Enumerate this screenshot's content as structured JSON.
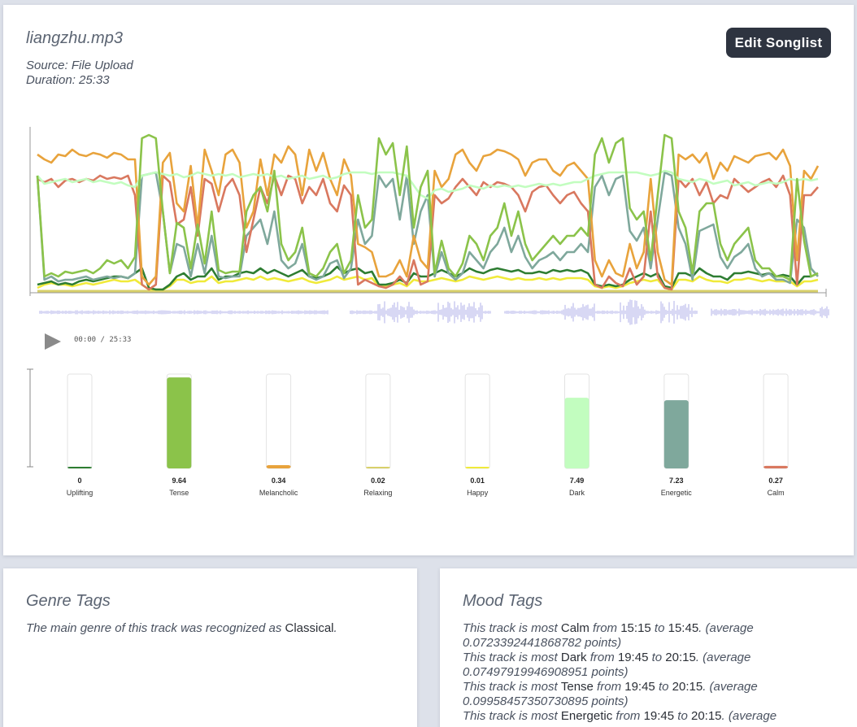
{
  "track": {
    "title": "liangzhu.mp3",
    "source": "Source: File Upload",
    "duration": "Duration: 25:33"
  },
  "toolbar": {
    "edit_label": "Edit Songlist"
  },
  "player": {
    "current": "00:00",
    "separator": " / ",
    "total": "25:33"
  },
  "colors": {
    "tense": "#8bc34a",
    "melancholic": "#e8a33c",
    "calm": "#d9785f",
    "dark": "#c2fdbf",
    "energetic": "#7fa89c",
    "uplifting": "#2e7d32",
    "happy": "#f0ea3a",
    "relaxing": "#d8d06a",
    "waveform": "#c8c8f0"
  },
  "chart_data": {
    "type": "line",
    "x_range": [
      0,
      1
    ],
    "ylim": [
      0,
      1
    ],
    "series": [
      {
        "name": "Tense",
        "key": "tense",
        "values": [
          0.72,
          0.1,
          0.12,
          0.1,
          0.13,
          0.12,
          0.13,
          0.14,
          0.12,
          0.15,
          0.2,
          0.18,
          0.2,
          0.15,
          0.22,
          0.95,
          0.97,
          0.95,
          0.5,
          0.12,
          0.43,
          0.4,
          0.15,
          0.42,
          0.18,
          0.5,
          0.14,
          0.12,
          0.13,
          0.13,
          0.5,
          0.6,
          0.65,
          0.5,
          0.75,
          0.3,
          0.2,
          0.25,
          0.4,
          0.12,
          0.1,
          0.15,
          0.25,
          0.3,
          0.12,
          0.2,
          0.6,
          0.4,
          0.45,
          0.95,
          0.85,
          0.92,
          0.6,
          0.9,
          0.4,
          0.65,
          0.75,
          0.12,
          0.32,
          0.15,
          0.1,
          0.18,
          0.35,
          0.3,
          0.2,
          0.35,
          0.4,
          0.55,
          0.35,
          0.5,
          0.3,
          0.2,
          0.25,
          0.3,
          0.35,
          0.3,
          0.35,
          0.35,
          0.4,
          0.35,
          0.85,
          0.95,
          0.8,
          0.92,
          0.95,
          0.52,
          0.45,
          0.5,
          0.2,
          0.6,
          0.97,
          0.95,
          0.5,
          0.4,
          0.12,
          0.5,
          0.55,
          0.55,
          0.3,
          0.2,
          0.3,
          0.35,
          0.4,
          0.2,
          0.15,
          0.15,
          0.1,
          0.1,
          0.08,
          0.7,
          0.32,
          0.1,
          0.12
        ]
      },
      {
        "name": "Melancholic",
        "key": "melancholic",
        "values": [
          0.85,
          0.82,
          0.8,
          0.85,
          0.84,
          0.88,
          0.85,
          0.84,
          0.86,
          0.85,
          0.83,
          0.86,
          0.85,
          0.82,
          0.82,
          0.1,
          0.05,
          0.1,
          0.8,
          0.86,
          0.55,
          0.5,
          0.78,
          0.4,
          0.88,
          0.75,
          0.6,
          0.85,
          0.88,
          0.8,
          0.4,
          0.5,
          0.82,
          0.6,
          0.85,
          0.8,
          0.9,
          0.85,
          0.6,
          0.88,
          0.75,
          0.86,
          0.7,
          0.6,
          0.82,
          0.72,
          0.3,
          0.28,
          0.25,
          0.1,
          0.1,
          0.12,
          0.2,
          0.1,
          0.35,
          0.2,
          0.15,
          0.75,
          0.65,
          0.7,
          0.85,
          0.88,
          0.8,
          0.75,
          0.84,
          0.85,
          0.88,
          0.87,
          0.85,
          0.82,
          0.72,
          0.8,
          0.82,
          0.82,
          0.75,
          0.72,
          0.78,
          0.8,
          0.75,
          0.7,
          0.2,
          0.1,
          0.2,
          0.12,
          0.1,
          0.3,
          0.15,
          0.25,
          0.7,
          0.25,
          0.08,
          0.05,
          0.85,
          0.82,
          0.85,
          0.8,
          0.86,
          0.7,
          0.8,
          0.75,
          0.84,
          0.82,
          0.8,
          0.84,
          0.85,
          0.86,
          0.82,
          0.88,
          0.78,
          0.2,
          0.75,
          0.7,
          0.78
        ]
      },
      {
        "name": "Calm",
        "key": "calm",
        "values": [
          0.7,
          0.68,
          0.7,
          0.65,
          0.69,
          0.7,
          0.68,
          0.7,
          0.69,
          0.72,
          0.7,
          0.71,
          0.7,
          0.72,
          0.6,
          0.05,
          0.02,
          0.05,
          0.72,
          0.68,
          0.42,
          0.45,
          0.65,
          0.35,
          0.7,
          0.67,
          0.5,
          0.65,
          0.7,
          0.6,
          0.25,
          0.45,
          0.65,
          0.55,
          0.72,
          0.6,
          0.72,
          0.7,
          0.55,
          0.65,
          0.6,
          0.7,
          0.55,
          0.5,
          0.66,
          0.6,
          0.05,
          0.08,
          0.06,
          0.04,
          0.03,
          0.05,
          0.1,
          0.05,
          0.2,
          0.05,
          0.07,
          0.6,
          0.55,
          0.58,
          0.65,
          0.7,
          0.65,
          0.6,
          0.68,
          0.65,
          0.68,
          0.67,
          0.65,
          0.6,
          0.5,
          0.62,
          0.65,
          0.66,
          0.6,
          0.55,
          0.6,
          0.62,
          0.55,
          0.5,
          0.05,
          0.03,
          0.1,
          0.06,
          0.04,
          0.15,
          0.05,
          0.1,
          0.5,
          0.1,
          0.03,
          0.02,
          0.7,
          0.65,
          0.7,
          0.6,
          0.68,
          0.55,
          0.6,
          0.58,
          0.7,
          0.66,
          0.62,
          0.65,
          0.68,
          0.7,
          0.65,
          0.72,
          0.6,
          0.05,
          0.6,
          0.6,
          0.65
        ]
      },
      {
        "name": "Dark",
        "key": "dark",
        "values": [
          0.72,
          0.67,
          0.68,
          0.69,
          0.7,
          0.68,
          0.69,
          0.7,
          0.68,
          0.69,
          0.68,
          0.67,
          0.68,
          0.66,
          0.65,
          0.72,
          0.73,
          0.74,
          0.73,
          0.72,
          0.73,
          0.71,
          0.72,
          0.74,
          0.73,
          0.72,
          0.73,
          0.72,
          0.73,
          0.71,
          0.72,
          0.73,
          0.72,
          0.73,
          0.71,
          0.72,
          0.7,
          0.71,
          0.72,
          0.7,
          0.71,
          0.72,
          0.7,
          0.71,
          0.73,
          0.74,
          0.74,
          0.74,
          0.73,
          0.74,
          0.74,
          0.74,
          0.73,
          0.72,
          0.66,
          0.6,
          0.58,
          0.63,
          0.64,
          0.62,
          0.63,
          0.64,
          0.66,
          0.65,
          0.64,
          0.66,
          0.65,
          0.66,
          0.65,
          0.66,
          0.65,
          0.66,
          0.67,
          0.66,
          0.67,
          0.66,
          0.67,
          0.68,
          0.68,
          0.7,
          0.72,
          0.73,
          0.74,
          0.74,
          0.74,
          0.74,
          0.74,
          0.73,
          0.72,
          0.73,
          0.75,
          0.74,
          0.7,
          0.69,
          0.68,
          0.7,
          0.69,
          0.67,
          0.68,
          0.69,
          0.66,
          0.67,
          0.68,
          0.66,
          0.67,
          0.68,
          0.67,
          0.68,
          0.7,
          0.69,
          0.7,
          0.69,
          0.7
        ]
      },
      {
        "name": "Energetic",
        "key": "energetic",
        "values": [
          0.72,
          0.08,
          0.1,
          0.07,
          0.08,
          0.08,
          0.09,
          0.1,
          0.08,
          0.09,
          0.1,
          0.09,
          0.1,
          0.09,
          0.12,
          0.72,
          0.73,
          0.74,
          0.5,
          0.12,
          0.3,
          0.28,
          0.1,
          0.3,
          0.12,
          0.35,
          0.1,
          0.09,
          0.1,
          0.1,
          0.35,
          0.4,
          0.45,
          0.3,
          0.5,
          0.2,
          0.15,
          0.18,
          0.3,
          0.1,
          0.08,
          0.1,
          0.18,
          0.2,
          0.09,
          0.15,
          0.45,
          0.3,
          0.35,
          0.72,
          0.65,
          0.7,
          0.45,
          0.72,
          0.3,
          0.5,
          0.6,
          0.1,
          0.25,
          0.12,
          0.08,
          0.12,
          0.25,
          0.2,
          0.15,
          0.25,
          0.3,
          0.4,
          0.25,
          0.35,
          0.22,
          0.15,
          0.2,
          0.22,
          0.25,
          0.2,
          0.25,
          0.25,
          0.3,
          0.25,
          0.65,
          0.72,
          0.6,
          0.7,
          0.72,
          0.38,
          0.32,
          0.4,
          0.15,
          0.45,
          0.74,
          0.72,
          0.4,
          0.3,
          0.08,
          0.38,
          0.4,
          0.42,
          0.22,
          0.15,
          0.22,
          0.25,
          0.3,
          0.15,
          0.1,
          0.12,
          0.08,
          0.08,
          0.06,
          0.45,
          0.4,
          0.15,
          0.1
        ]
      },
      {
        "name": "Uplifting",
        "key": "uplifting",
        "values": [
          0.05,
          0.06,
          0.07,
          0.05,
          0.06,
          0.05,
          0.07,
          0.08,
          0.07,
          0.08,
          0.09,
          0.1,
          0.1,
          0.09,
          0.12,
          0.15,
          0.03,
          0.02,
          0.02,
          0.05,
          0.1,
          0.12,
          0.08,
          0.1,
          0.1,
          0.15,
          0.08,
          0.1,
          0.1,
          0.12,
          0.13,
          0.12,
          0.15,
          0.12,
          0.14,
          0.12,
          0.1,
          0.12,
          0.14,
          0.1,
          0.09,
          0.1,
          0.12,
          0.16,
          0.12,
          0.14,
          0.15,
          0.12,
          0.13,
          0.05,
          0.05,
          0.06,
          0.08,
          0.06,
          0.12,
          0.1,
          0.1,
          0.12,
          0.14,
          0.12,
          0.1,
          0.12,
          0.15,
          0.13,
          0.12,
          0.14,
          0.15,
          0.14,
          0.13,
          0.14,
          0.12,
          0.12,
          0.13,
          0.12,
          0.14,
          0.13,
          0.14,
          0.13,
          0.14,
          0.12,
          0.05,
          0.04,
          0.05,
          0.04,
          0.05,
          0.08,
          0.1,
          0.12,
          0.1,
          0.12,
          0.04,
          0.03,
          0.12,
          0.12,
          0.1,
          0.15,
          0.12,
          0.1,
          0.1,
          0.08,
          0.12,
          0.12,
          0.13,
          0.12,
          0.11,
          0.12,
          0.1,
          0.11,
          0.1,
          0.05,
          0.1,
          0.1,
          0.12
        ]
      },
      {
        "name": "Happy",
        "key": "happy",
        "values": [
          0.03,
          0.05,
          0.06,
          0.05,
          0.05,
          0.04,
          0.05,
          0.06,
          0.05,
          0.06,
          0.07,
          0.08,
          0.07,
          0.07,
          0.08,
          0.05,
          0.02,
          0.02,
          0.02,
          0.04,
          0.08,
          0.08,
          0.06,
          0.07,
          0.07,
          0.1,
          0.06,
          0.07,
          0.07,
          0.08,
          0.09,
          0.08,
          0.1,
          0.08,
          0.09,
          0.08,
          0.07,
          0.08,
          0.09,
          0.07,
          0.06,
          0.07,
          0.08,
          0.1,
          0.08,
          0.09,
          0.1,
          0.08,
          0.09,
          0.04,
          0.04,
          0.05,
          0.06,
          0.04,
          0.08,
          0.07,
          0.07,
          0.08,
          0.09,
          0.08,
          0.07,
          0.08,
          0.1,
          0.09,
          0.08,
          0.09,
          0.1,
          0.09,
          0.08,
          0.09,
          0.08,
          0.08,
          0.09,
          0.08,
          0.09,
          0.08,
          0.09,
          0.09,
          0.09,
          0.08,
          0.04,
          0.03,
          0.04,
          0.03,
          0.04,
          0.06,
          0.07,
          0.08,
          0.07,
          0.08,
          0.03,
          0.02,
          0.08,
          0.08,
          0.07,
          0.1,
          0.08,
          0.07,
          0.07,
          0.06,
          0.08,
          0.08,
          0.09,
          0.08,
          0.07,
          0.08,
          0.07,
          0.07,
          0.07,
          0.04,
          0.07,
          0.07,
          0.08
        ]
      },
      {
        "name": "Relaxing",
        "key": "relaxing",
        "values": [
          0.01,
          0.01,
          0.01,
          0.01,
          0.01,
          0.01,
          0.01,
          0.01,
          0.01,
          0.01,
          0.01,
          0.01,
          0.01,
          0.01,
          0.01,
          0.01,
          0.01,
          0.01,
          0.01,
          0.01,
          0.01,
          0.01,
          0.01,
          0.01,
          0.01,
          0.01,
          0.01,
          0.01,
          0.01,
          0.01,
          0.01,
          0.01,
          0.01,
          0.01,
          0.01,
          0.01,
          0.01,
          0.01,
          0.01,
          0.01,
          0.01,
          0.01,
          0.01,
          0.01,
          0.01,
          0.01,
          0.01,
          0.01,
          0.01,
          0.01,
          0.01,
          0.01,
          0.01,
          0.01,
          0.01,
          0.01,
          0.01,
          0.01,
          0.01,
          0.01,
          0.01,
          0.01,
          0.01,
          0.01,
          0.01,
          0.01,
          0.01,
          0.01,
          0.01,
          0.01,
          0.01,
          0.01,
          0.01,
          0.01,
          0.01,
          0.01,
          0.01,
          0.01,
          0.01,
          0.01,
          0.01,
          0.01,
          0.01,
          0.01,
          0.01,
          0.01,
          0.01,
          0.01,
          0.01,
          0.01,
          0.01,
          0.01,
          0.01,
          0.01,
          0.01,
          0.01,
          0.01,
          0.01,
          0.01,
          0.01,
          0.01,
          0.01,
          0.01,
          0.01,
          0.01,
          0.01,
          0.01,
          0.01,
          0.01,
          0.01,
          0.01,
          0.01,
          0.01
        ]
      }
    ]
  },
  "mood_bars": {
    "ylim": [
      0,
      10
    ],
    "items": [
      {
        "label": "Uplifting",
        "value": 0,
        "display": "0",
        "key": "uplifting"
      },
      {
        "label": "Tense",
        "value": 9.64,
        "display": "9.64",
        "key": "tense"
      },
      {
        "label": "Melancholic",
        "value": 0.34,
        "display": "0.34",
        "key": "melancholic"
      },
      {
        "label": "Relaxing",
        "value": 0.02,
        "display": "0.02",
        "key": "relaxing"
      },
      {
        "label": "Happy",
        "value": 0.01,
        "display": "0.01",
        "key": "happy"
      },
      {
        "label": "Dark",
        "value": 7.49,
        "display": "7.49",
        "key": "dark"
      },
      {
        "label": "Energetic",
        "value": 7.23,
        "display": "7.23",
        "key": "energetic"
      },
      {
        "label": "Calm",
        "value": 0.27,
        "display": "0.27",
        "key": "calm"
      }
    ]
  },
  "genre": {
    "title": "Genre Tags",
    "text_before": "The main genre of this track was recognized as ",
    "genre_name": "Classical",
    "text_after": "."
  },
  "mood": {
    "title": "Mood Tags",
    "lines": [
      {
        "pre": "This track is most ",
        "mood": "Calm",
        "mid1": " from ",
        "from": "15:15",
        "mid2": " to ",
        "to": "15:45",
        "post": ". (average 0.0723392441868782 points)"
      },
      {
        "pre": "This track is most ",
        "mood": "Dark",
        "mid1": " from ",
        "from": "19:45",
        "mid2": " to ",
        "to": "20:15",
        "post": ". (average 0.07497919946908951 points)"
      },
      {
        "pre": "This track is most ",
        "mood": "Tense",
        "mid1": " from ",
        "from": "19:45",
        "mid2": " to ",
        "to": "20:15",
        "post": ". (average 0.09958457350730895 points)"
      },
      {
        "pre": "This track is most ",
        "mood": "Energetic",
        "mid1": " from ",
        "from": "19:45",
        "mid2": " to ",
        "to": "20:15",
        "post": ". (average"
      }
    ]
  }
}
